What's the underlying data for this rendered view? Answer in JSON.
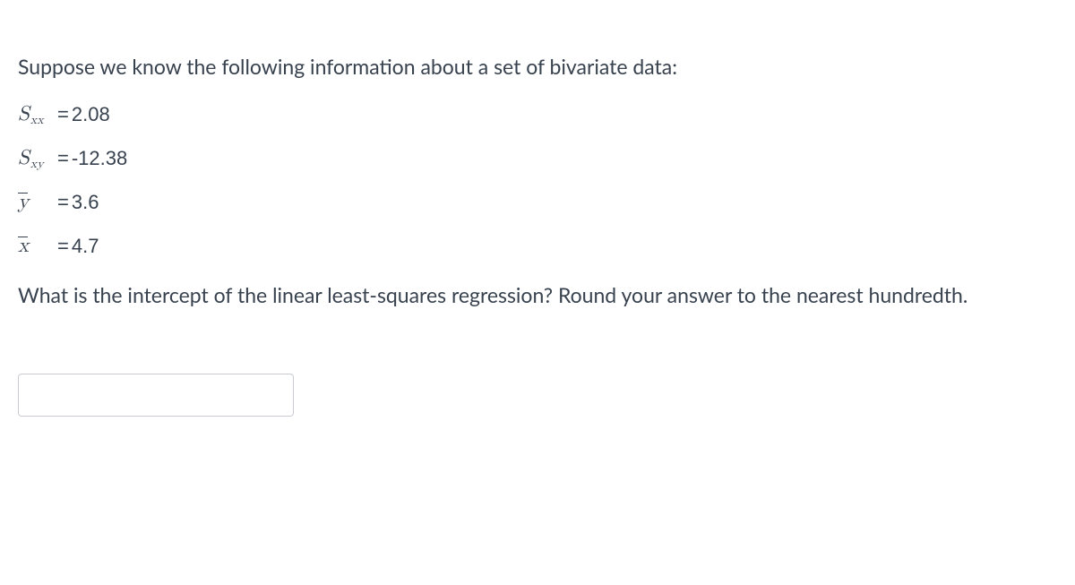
{
  "intro": "Suppose we know the following information about a set of bivariate data:",
  "equations": {
    "sxx": {
      "symbol_main": "S",
      "symbol_sub": "xx",
      "eq": "=",
      "value": "2.08"
    },
    "sxy": {
      "symbol_main": "S",
      "symbol_sub": "xy",
      "eq": "=",
      "value": "-12.38"
    },
    "ybar": {
      "symbol_main": "y",
      "eq": "=",
      "value": "3.6"
    },
    "xbar": {
      "symbol_main": "x",
      "eq": "=",
      "value": "4.7"
    }
  },
  "question": "What is the intercept of the linear least-squares regression? Round your answer to the nearest hundredth.",
  "answer_value": ""
}
